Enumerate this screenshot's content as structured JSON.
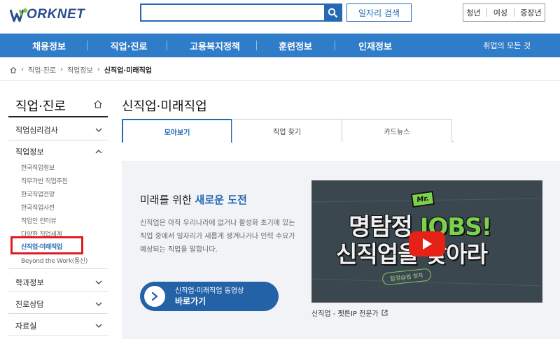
{
  "header": {
    "logo_text": "ORKNET",
    "search_placeholder": "",
    "job_search_label": "일자리 검색",
    "audience": [
      "청년",
      "여성",
      "중장년"
    ]
  },
  "nav": {
    "items": [
      "채용정보",
      "직업·진로",
      "고용복지정책",
      "훈련정보",
      "인재정보"
    ],
    "all_menu": "취업의 모든 것"
  },
  "breadcrumb": [
    "홈",
    "직업·진로",
    "직업정보",
    "신직업·미래직업"
  ],
  "sidebar": {
    "title": "직업·진로",
    "sections": [
      {
        "label": "직업심리검사"
      },
      {
        "label": "직업정보"
      },
      {
        "label": "학과정보"
      },
      {
        "label": "진로상담"
      },
      {
        "label": "자료실"
      }
    ],
    "sub_items": [
      "한국직업정보",
      "직무가반 직업추천",
      "한국직업전망",
      "한국직업사전",
      "직업인 인터뷰",
      "다양한 직업세계",
      "신직업·미래직업",
      "Beyond the Work(통신)"
    ]
  },
  "main": {
    "title": "신직업·미래직업",
    "tabs": [
      "모아보기",
      "직업 찾기",
      "카드뉴스"
    ],
    "headline_prefix": "미래를 위한 ",
    "headline_accent": "새로운 도전",
    "description": "신직업은 아직 우리나라에 없거나 활성화 초기에 있는 직업 중에서 일자리가 새롭게 생겨나거나 인력 수요가 예상되는 직업을 말합니다.",
    "video_button_line1": "신직업·미래직업 동영상",
    "video_button_line2": "바로가기",
    "video_caption": "신직업 - 펫튼IP 전문가",
    "thumb": {
      "mr": "Mr.",
      "line1_white": "명탐정 ",
      "line1_green": "JOBS!",
      "line2": "신직업을 찾아라",
      "badge": "탐정@업 찾자"
    }
  },
  "colors": {
    "brand_blue": "#2f7cc9",
    "accent_blue": "#2569b5",
    "highlight_red": "#e01b22",
    "youtube_red": "#e62117"
  }
}
